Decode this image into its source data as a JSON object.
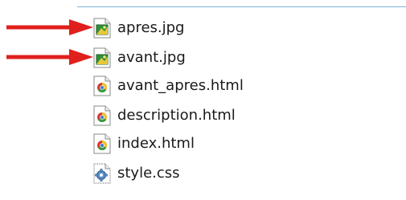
{
  "files": [
    {
      "name": "apres.jpg",
      "icon": "image-file-icon"
    },
    {
      "name": "avant.jpg",
      "icon": "image-file-icon"
    },
    {
      "name": "avant_apres.html",
      "icon": "chrome-html-file-icon"
    },
    {
      "name": "description.html",
      "icon": "chrome-html-file-icon"
    },
    {
      "name": "index.html",
      "icon": "chrome-html-file-icon"
    },
    {
      "name": "style.css",
      "icon": "css-gear-file-icon"
    }
  ],
  "colors": {
    "arrow": "#e0201c",
    "divider": "#7fb2d9",
    "text": "#1a1a1a"
  },
  "annotations": {
    "arrows_point_to": [
      "apres.jpg",
      "avant.jpg"
    ]
  }
}
